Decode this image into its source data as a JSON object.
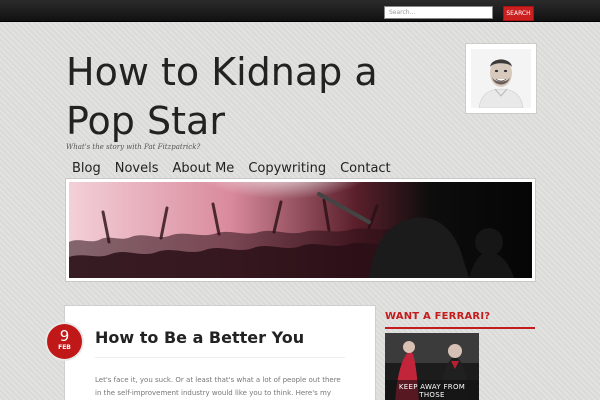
{
  "search": {
    "placeholder": "Search...",
    "button_label": "SEARCH"
  },
  "site": {
    "title": "How to Kidnap a Pop Star",
    "tagline": "What's the story with Pat Fitzpatrick?"
  },
  "nav": {
    "items": [
      {
        "label": "Blog"
      },
      {
        "label": "Novels"
      },
      {
        "label": "About Me"
      },
      {
        "label": "Copywriting"
      },
      {
        "label": "Contact"
      }
    ]
  },
  "post": {
    "date_day": "9",
    "date_month": "FEB",
    "title": "How to Be a Better You",
    "excerpt": "Let's face it, you suck. Or at least that's what a lot of people out there in the self-improvement industry would like you to think. Here's my look at"
  },
  "sidebar": {
    "widget_title": "WANT A FERRARI?",
    "book_cover_text": "KEEP AWAY FROM THOSE"
  },
  "colors": {
    "accent_red": "#c41c1c",
    "topbar": "#1a1a1a",
    "background": "#dededd"
  },
  "icons": {
    "avatar": "author-photo",
    "banner": "concert-crowd-image",
    "book": "book-cover-image"
  }
}
